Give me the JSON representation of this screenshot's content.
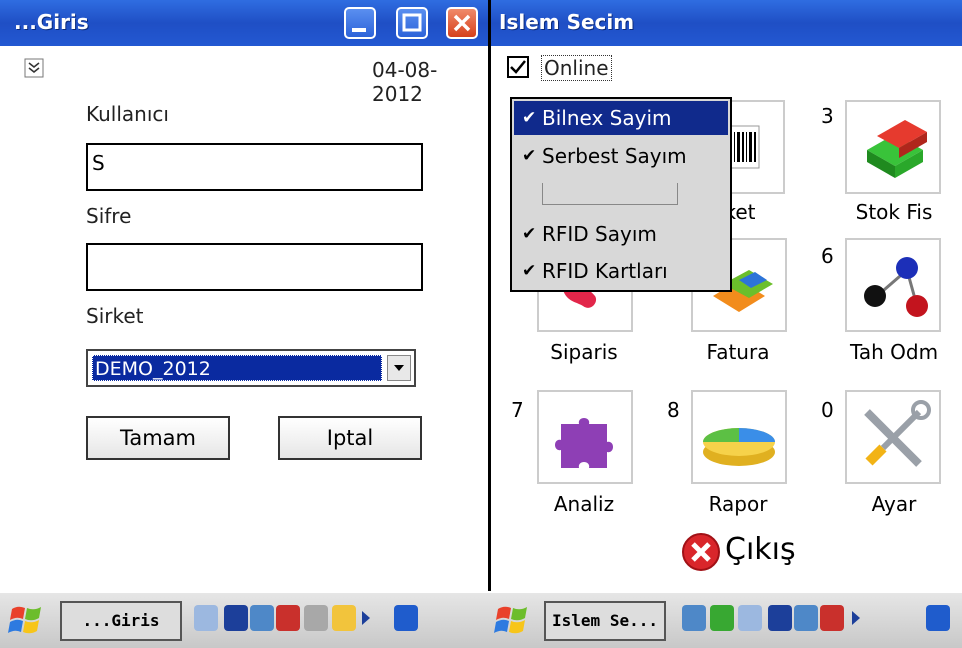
{
  "left_window": {
    "title": "...Giris",
    "date": "04-08-2012",
    "username_label": "Kullanıcı",
    "username_value": "S",
    "password_label": "Sifre",
    "password_value": "",
    "company_label": "Sirket",
    "company_value": "DEMO_2012",
    "ok_label": "Tamam",
    "cancel_label": "Iptal"
  },
  "right_window": {
    "title": "Islem Secim",
    "online_label": "Online",
    "online_checked": true,
    "menu": [
      {
        "label": "Bilnex Sayim",
        "checked": true,
        "selected": true
      },
      {
        "label": "Serbest Sayım",
        "checked": true
      },
      {
        "label": "",
        "checked": false
      },
      {
        "label": "RFID Sayım",
        "checked": true
      },
      {
        "label": "RFID Kartları",
        "checked": true
      }
    ],
    "tiles": [
      {
        "num": "",
        "label": "ket",
        "icon": "barcode-icon"
      },
      {
        "num": "3",
        "label": "Stok Fis",
        "icon": "stock-cubes-icon"
      },
      {
        "num": "",
        "label": "Siparis",
        "icon": "order-icon"
      },
      {
        "num": "",
        "label": "Fatura",
        "icon": "invoice-icon"
      },
      {
        "num": "6",
        "label": "Tah Odm",
        "icon": "payment-spheres-icon"
      },
      {
        "num": "7",
        "label": "Analiz",
        "icon": "puzzle-icon"
      },
      {
        "num": "8",
        "label": "Rapor",
        "icon": "pie-chart-icon"
      },
      {
        "num": "0",
        "label": "Ayar",
        "icon": "tools-icon"
      }
    ],
    "exit_label": "Çıkış"
  },
  "taskbar": {
    "task1": "...Giris",
    "task2": "Islem Se..."
  },
  "colors": {
    "titlebar": "#2358d2",
    "selection": "#102a8c"
  }
}
